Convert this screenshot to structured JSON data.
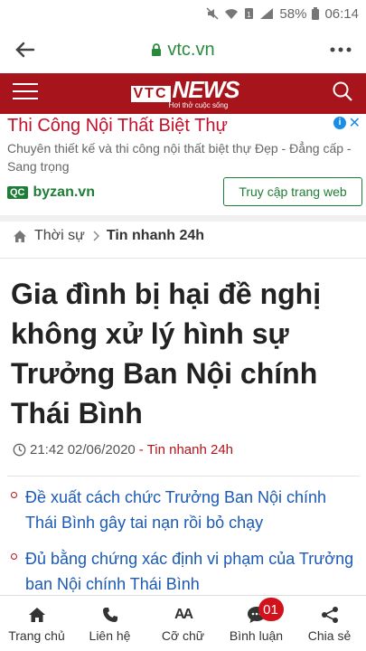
{
  "status_bar": {
    "battery": "58%",
    "time": "06:14"
  },
  "browser": {
    "url": "vtc.vn"
  },
  "header": {
    "logo_vtc": "VTC",
    "logo_news": "NEWS",
    "tagline": "Hơi thở cuộc sống"
  },
  "ad": {
    "title": "Thi Công Nội Thất Biệt Thự",
    "info_icon": "i",
    "close_icon": "✕",
    "description": "Chuyên thiết kế và thi công nội thất biệt thự Đẹp - Đẳng cấp - Sang trọng",
    "qc_label": "QC",
    "domain": "byzan.vn",
    "cta": "Truy cập trang web"
  },
  "breadcrumb": {
    "section": "Thời sự",
    "subsection": "Tin nhanh 24h"
  },
  "article": {
    "title": "Gia đình bị hại đề nghị không xử lý hình sự Trưởng Ban Nội chính Thái Bình",
    "datetime": "21:42 02/06/2020",
    "category": "- Tin nhanh 24h"
  },
  "related": [
    "Đề xuất cách chức Trưởng Ban Nội chính Thái Bình gây tai nạn rồi bỏ chạy",
    "Đủ bằng chứng xác định vi phạm của Trưởng ban Nội chính Thái Bình"
  ],
  "bottom_nav": {
    "home": "Trang chủ",
    "contact": "Liên hệ",
    "font_size": "Cỡ chữ",
    "font_icon": "AA",
    "comments": "Bình luận",
    "comment_count": "01",
    "share": "Chia sẻ"
  },
  "colors": {
    "brand": "#a8141b",
    "link": "#1b5ab5",
    "ad_green": "#1e7d36"
  }
}
